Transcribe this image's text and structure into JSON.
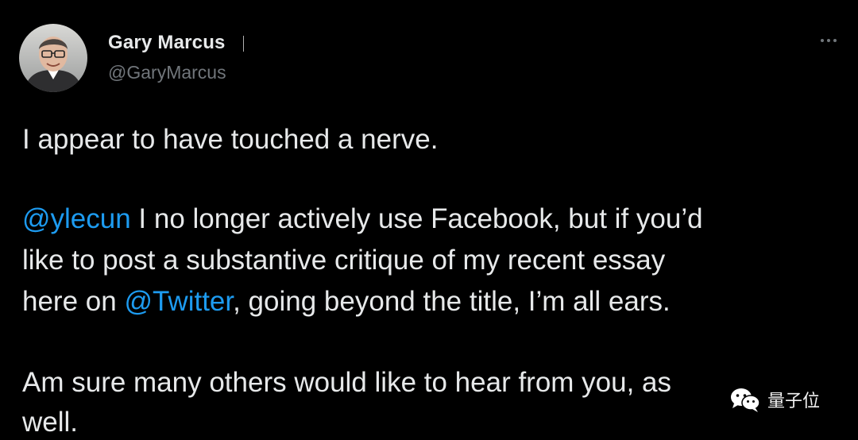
{
  "author": {
    "name": "Gary Marcus",
    "handle": "@GaryMarcus"
  },
  "menu": {
    "icon": "more-horizontal-icon"
  },
  "tweet": {
    "line1": "I appear to have touched a nerve.",
    "p2": {
      "mention1": "@ylecun",
      "line1_rest": " I no longer actively use Facebook, but if you’d",
      "line2": "like to post a substantive critique of my recent essay",
      "line3_pre": "here on ",
      "mention2": "@Twitter",
      "line3_post": ", going beyond the title, I’m all ears."
    },
    "p3": {
      "line1": "Am sure many others would like to hear from you, as",
      "line2": "well."
    }
  },
  "watermark": {
    "text": "量子位",
    "icon": "wechat-icon"
  },
  "colors": {
    "background": "#000000",
    "text": "#e7e9ea",
    "secondary": "#71767b",
    "link": "#1d9bf0"
  }
}
